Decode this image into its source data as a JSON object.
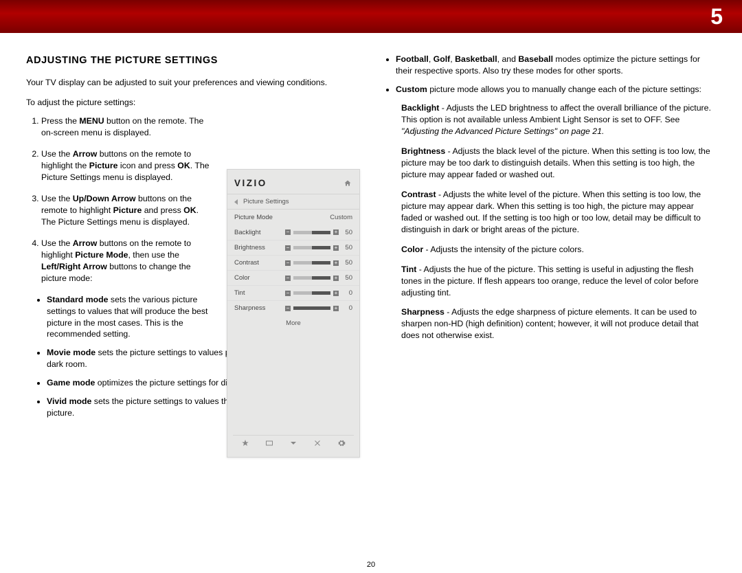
{
  "chapter_number": "5",
  "page_number": "20",
  "section_title": "ADJUSTING THE PICTURE SETTINGS",
  "intro": "Your TV display can be adjusted to suit your preferences and viewing conditions.",
  "subhead": "To adjust the picture settings:",
  "steps": {
    "s1_a": "Press the ",
    "s1_b": "MENU",
    "s1_c": " button on the remote. The on-screen menu is displayed.",
    "s2_a": "Use the ",
    "s2_b": "Arrow",
    "s2_c": " buttons on the remote to highlight the ",
    "s2_d": "Picture",
    "s2_e": " icon and press ",
    "s2_f": "OK",
    "s2_g": ". The Picture Settings menu is displayed.",
    "s3_a": "Use the ",
    "s3_b": "Up/Down Arrow",
    "s3_c": " buttons on the remote to highlight ",
    "s3_d": "Picture",
    "s3_e": " and press ",
    "s3_f": "OK",
    "s3_g": ". The Picture Settings menu is displayed.",
    "s4_a": "Use the ",
    "s4_b": "Arrow",
    "s4_c": " buttons on the remote to highlight ",
    "s4_d": "Picture Mode",
    "s4_e": ", then use the ",
    "s4_f": "Left/Right Arrow",
    "s4_g": " buttons to change the picture mode:"
  },
  "modes": {
    "standard_b": "Standard mode",
    "standard_t": " sets the various picture settings to values that will produce the best picture in the most cases. This is the recommended setting.",
    "movie_b": "Movie mode",
    "movie_t": " sets the picture settings to values perfect for watching a movie in a dark room.",
    "game_b": "Game mode",
    "game_t": " optimizes the picture settings for displaying game console output.",
    "vivid_b": "Vivid mode",
    "vivid_t": " sets the picture settings to values that produce a brighter, more vivid picture.",
    "sports_b1": "Football",
    "sports_s1": ", ",
    "sports_b2": "Golf",
    "sports_s2": ", ",
    "sports_b3": "Basketball",
    "sports_s3": ", and ",
    "sports_b4": "Baseball",
    "sports_t": " modes optimize the picture settings for their respective sports. Also try these modes for other sports.",
    "custom_b": "Custom",
    "custom_t": " picture mode allows you to manually change each of the picture settings:"
  },
  "defs": {
    "backlight_b": "Backlight",
    "backlight_t": " - Adjusts the LED brightness to affect the overall brilliance of the picture. This option is not available unless Ambient Light Sensor is set to OFF. See ",
    "backlight_i": "\"Adjusting the Advanced Picture Settings\" on page 21.",
    "brightness_b": "Brightness",
    "brightness_t": " - Adjusts the black level of the picture. When this setting is too low, the picture may be too dark to distinguish details. When this setting is too high, the picture may appear faded or washed out.",
    "contrast_b": "Contrast",
    "contrast_t": " - Adjusts the white level of the picture. When this setting is too low, the picture may appear dark. When this setting is too high, the picture may appear faded or washed out. If the setting is too high or too low, detail may be difficult to distinguish in dark or bright areas of the picture.",
    "color_b": "Color",
    "color_t": " - Adjusts the intensity of the picture colors.",
    "tint_b": "Tint",
    "tint_t": " - Adjusts the hue of the picture. This setting is useful in adjusting the flesh tones in the picture. If flesh appears too orange, reduce the level of color before adjusting tint.",
    "sharp_b": "Sharpness",
    "sharp_t": " - Adjusts the edge sharpness of picture elements. It can be used to sharpen non-HD (high definition) content; however, it will not produce detail that does not otherwise exist."
  },
  "osd": {
    "logo": "VIZIO",
    "crumb": "Picture Settings",
    "mode_label": "Picture Mode",
    "mode_value": "Custom",
    "rows": [
      {
        "label": "Backlight",
        "value": "50",
        "fill": 50
      },
      {
        "label": "Brightness",
        "value": "50",
        "fill": 50
      },
      {
        "label": "Contrast",
        "value": "50",
        "fill": 50
      },
      {
        "label": "Color",
        "value": "50",
        "fill": 50
      },
      {
        "label": "Tint",
        "value": "0",
        "fill": 50
      },
      {
        "label": "Sharpness",
        "value": "0",
        "fill": 0
      }
    ],
    "more": "More"
  }
}
